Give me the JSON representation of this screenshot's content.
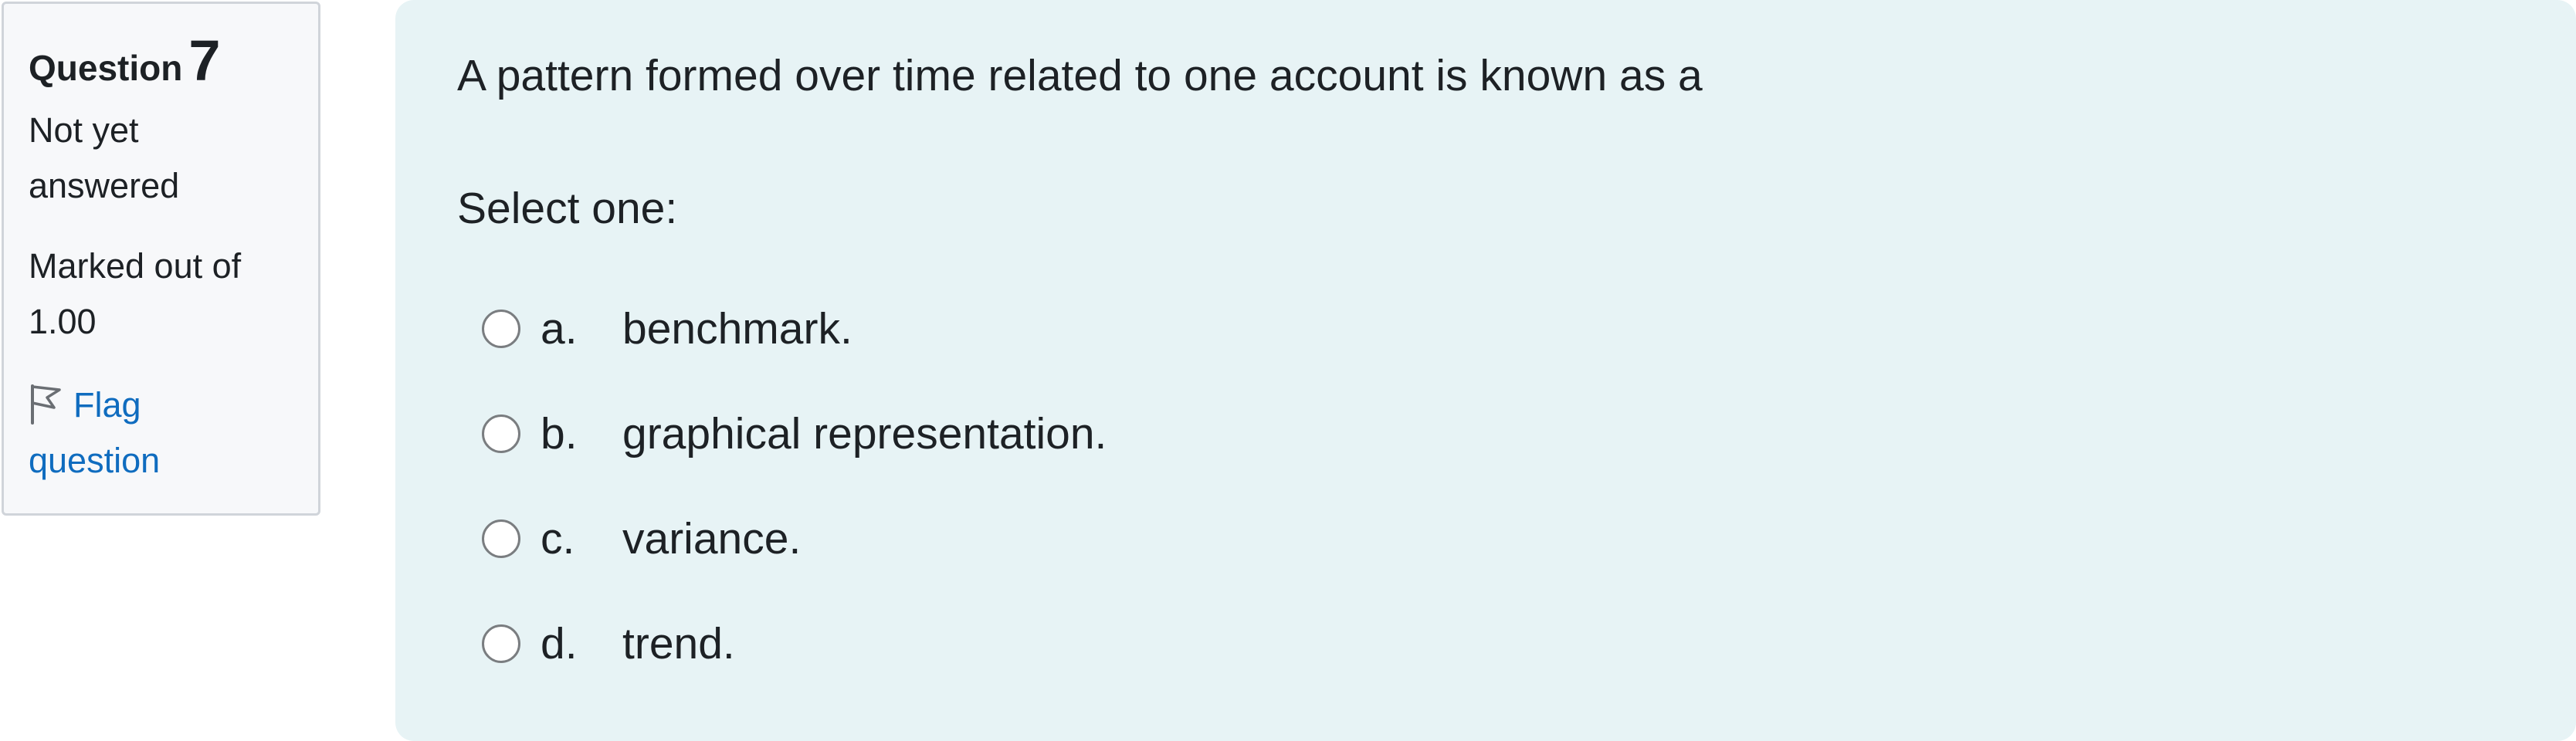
{
  "info": {
    "question_label": "Question",
    "question_number": "7",
    "state_line1": "Not yet",
    "state_line2": "answered",
    "grade_line1": "Marked out of",
    "grade_line2": "1.00",
    "flag_line1": "Flag",
    "flag_line2": "question",
    "flag_icon": "flag-icon"
  },
  "question": {
    "text": "A pattern formed over time related to one account is known as a",
    "prompt": "Select one:",
    "answers": [
      {
        "letter": "a.",
        "text": "benchmark.",
        "selected": false
      },
      {
        "letter": "b.",
        "text": "graphical representation.",
        "selected": false
      },
      {
        "letter": "c.",
        "text": "variance.",
        "selected": false
      },
      {
        "letter": "d.",
        "text": "trend.",
        "selected": false
      }
    ]
  },
  "colors": {
    "content_bg": "#e7f3f5",
    "info_bg": "#f7f8fa",
    "link": "#0f6cbf",
    "text": "#1d2125"
  }
}
